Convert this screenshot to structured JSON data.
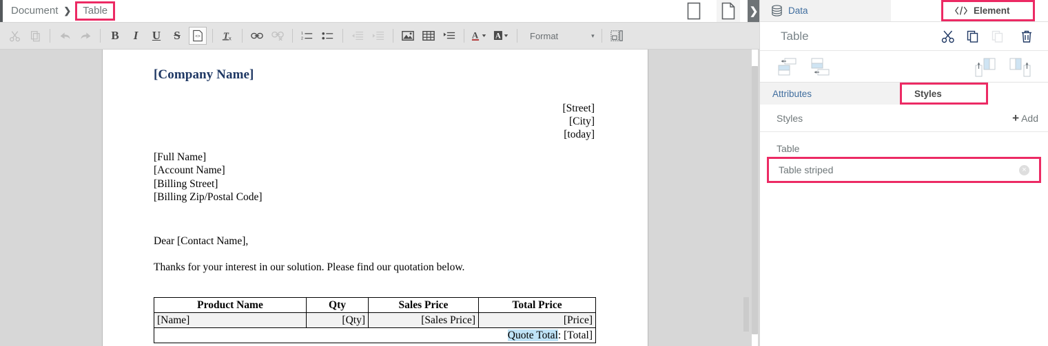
{
  "breadcrumb": {
    "items": [
      {
        "label": "Document",
        "highlighted": false
      },
      {
        "label": "Table",
        "highlighted": true
      }
    ],
    "separator": "❯"
  },
  "page_view_icons": [
    {
      "name": "page-view-icon",
      "label": ""
    },
    {
      "name": "page-break-icon",
      "label": ""
    }
  ],
  "panel_toggle": {
    "glyph": "❯",
    "name": "panel-toggle-chevron"
  },
  "toolbar": {
    "buttons": [
      {
        "name": "cut-button",
        "icon": "scissors-icon",
        "disabled": true
      },
      {
        "name": "copy-button",
        "icon": "copy-icon",
        "disabled": true
      },
      {
        "name": "undo-button",
        "icon": "undo-arrow-icon",
        "disabled": true
      },
      {
        "name": "redo-button",
        "icon": "redo-arrow-icon",
        "disabled": true
      },
      {
        "name": "bold-button",
        "icon": "bold-icon",
        "label": "B",
        "disabled": false
      },
      {
        "name": "italic-button",
        "icon": "italic-icon",
        "label": "I",
        "disabled": false
      },
      {
        "name": "underline-button",
        "icon": "underline-icon",
        "label": "U",
        "disabled": false
      },
      {
        "name": "strikethrough-button",
        "icon": "strikethrough-icon",
        "label": "S",
        "disabled": false
      },
      {
        "name": "source-code-button",
        "icon": "source-code-icon",
        "active": true
      },
      {
        "name": "remove-format-button",
        "icon": "remove-format-icon"
      },
      {
        "name": "link-button",
        "icon": "link-icon",
        "disabled": false
      },
      {
        "name": "unlink-button",
        "icon": "unlink-icon",
        "disabled": true
      },
      {
        "name": "numbered-list-button",
        "icon": "numbered-list-icon"
      },
      {
        "name": "bulleted-list-button",
        "icon": "bulleted-list-icon"
      },
      {
        "name": "decrease-indent-button",
        "icon": "decrease-indent-icon",
        "disabled": true
      },
      {
        "name": "increase-indent-button",
        "icon": "increase-indent-icon",
        "disabled": true
      },
      {
        "name": "insert-image-button",
        "icon": "image-icon"
      },
      {
        "name": "insert-table-button",
        "icon": "table-icon"
      },
      {
        "name": "insert-field-button",
        "icon": "insert-field-icon"
      },
      {
        "name": "text-color-button",
        "icon": "text-color-icon",
        "label": "A"
      },
      {
        "name": "background-color-button",
        "icon": "background-color-icon",
        "label": "A"
      }
    ],
    "format_dropdown": {
      "label": "Format",
      "caret": "▾"
    },
    "page_layout_button": {
      "name": "page-layout-icon"
    }
  },
  "document": {
    "company_name": "[Company Name]",
    "sender_lines": [
      "[Street]",
      "[City]",
      "[today]"
    ],
    "recipient_lines": [
      "[Full Name]",
      "[Account Name]",
      "[Billing Street]",
      "[Billing Zip/Postal Code]"
    ],
    "salutation": "Dear [Contact Name],",
    "intro": "Thanks for your interest in our solution. Please find our quotation below.",
    "table": {
      "headers": [
        "Product Name",
        "Qty",
        "Sales Price",
        "Total Price"
      ],
      "rows": [
        [
          "[Name]",
          "[Qty]",
          "[Sales Price]",
          "[Price]"
        ]
      ],
      "total_row": {
        "selected_text": "Quote Total",
        "suffix": ": [Total]"
      }
    }
  },
  "properties": {
    "tabs": [
      {
        "label": "Data",
        "icon": "database-icon",
        "active": false
      },
      {
        "label": "Element",
        "icon": "code-tag-icon",
        "active": true
      }
    ],
    "element_title": "Table",
    "actions": [
      {
        "name": "cut-element-button",
        "icon": "scissors-icon",
        "disabled": false
      },
      {
        "name": "copy-element-button",
        "icon": "copy-icon",
        "disabled": false
      },
      {
        "name": "paste-element-button",
        "icon": "paste-icon",
        "disabled": true
      },
      {
        "name": "delete-element-button",
        "icon": "trash-icon",
        "disabled": false
      }
    ],
    "table_ops": [
      {
        "name": "insert-row-above-button",
        "icon": "insert-row-above-icon"
      },
      {
        "name": "insert-row-below-button",
        "icon": "insert-row-below-icon"
      },
      {
        "name": "insert-column-left-button",
        "icon": "insert-column-left-icon"
      },
      {
        "name": "insert-column-right-button",
        "icon": "insert-column-right-icon"
      }
    ],
    "subtabs": [
      {
        "label": "Attributes",
        "active": false
      },
      {
        "label": "Styles",
        "active": true
      }
    ],
    "styles_section": {
      "header_label": "Styles",
      "add_label": "Add",
      "add_plus": "+",
      "group_label": "Table",
      "items": [
        {
          "label": "Table striped",
          "highlighted": true,
          "remove_glyph": "×"
        }
      ]
    }
  },
  "colors": {
    "highlight_pink": "#ec2a64",
    "company_navy": "#1f3864",
    "selection_blue": "#bfe3f7",
    "toolbar_bg": "#e4e4e4",
    "canvas_gray": "#d7d7d7",
    "link_blue": "#3f6d9e"
  }
}
